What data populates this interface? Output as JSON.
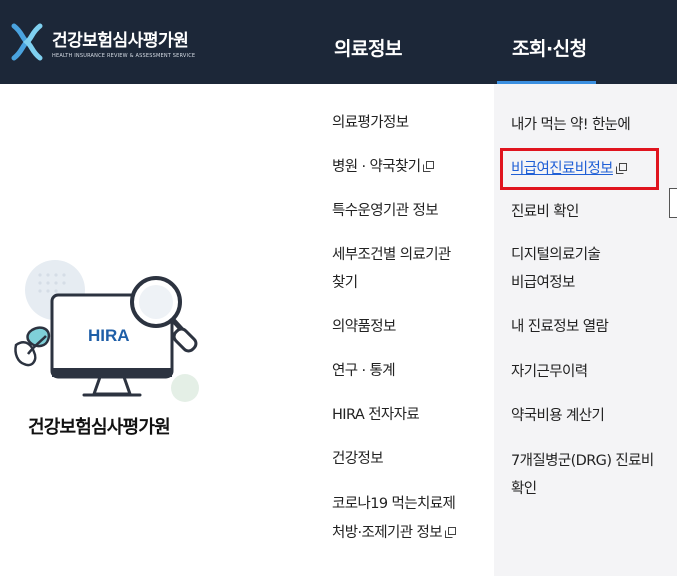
{
  "header": {
    "logo_title": "건강보험심사평가원",
    "logo_subtitle": "HEALTH INSURANCE REVIEW & ASSESSMENT SERVICE",
    "nav": [
      {
        "label": "의료정보"
      },
      {
        "label": "조회·신청"
      }
    ],
    "accent_color": "#3a8fe0",
    "background_color": "#1c2738"
  },
  "left": {
    "monitor_label": "HIRA",
    "brand_name": "건강보험심사평가원"
  },
  "menu_medical_info": [
    {
      "label": "의료평가정보"
    },
    {
      "label": "병원 · 약국찾기",
      "external": true
    },
    {
      "label": "특수운영기관 정보"
    },
    {
      "label": "세부조건별 의료기관"
    },
    {
      "label": "찾기"
    },
    {
      "label": "의약품정보"
    },
    {
      "label": "연구 · 통계"
    },
    {
      "label": "HIRA 전자자료"
    },
    {
      "label": "건강정보"
    },
    {
      "label": "코로나19 먹는치료제"
    },
    {
      "label": "처방·조제기관 정보",
      "external": true
    }
  ],
  "menu_inquiry": [
    {
      "label": "내가 먹는 약! 한눈에"
    },
    {
      "label": "비급여진료비정보",
      "external": true,
      "highlighted": true
    },
    {
      "label": "진료비 확인"
    },
    {
      "label": "디지털의료기술"
    },
    {
      "label": "비급여정보"
    },
    {
      "label": "내 진료정보 열람"
    },
    {
      "label": "자기근무이력"
    },
    {
      "label": "약국비용 계산기"
    },
    {
      "label": "7개질병군(DRG) 진료비"
    },
    {
      "label": "확인"
    }
  ],
  "highlight_color": "#e0141e",
  "link_color": "#1f5fd6"
}
